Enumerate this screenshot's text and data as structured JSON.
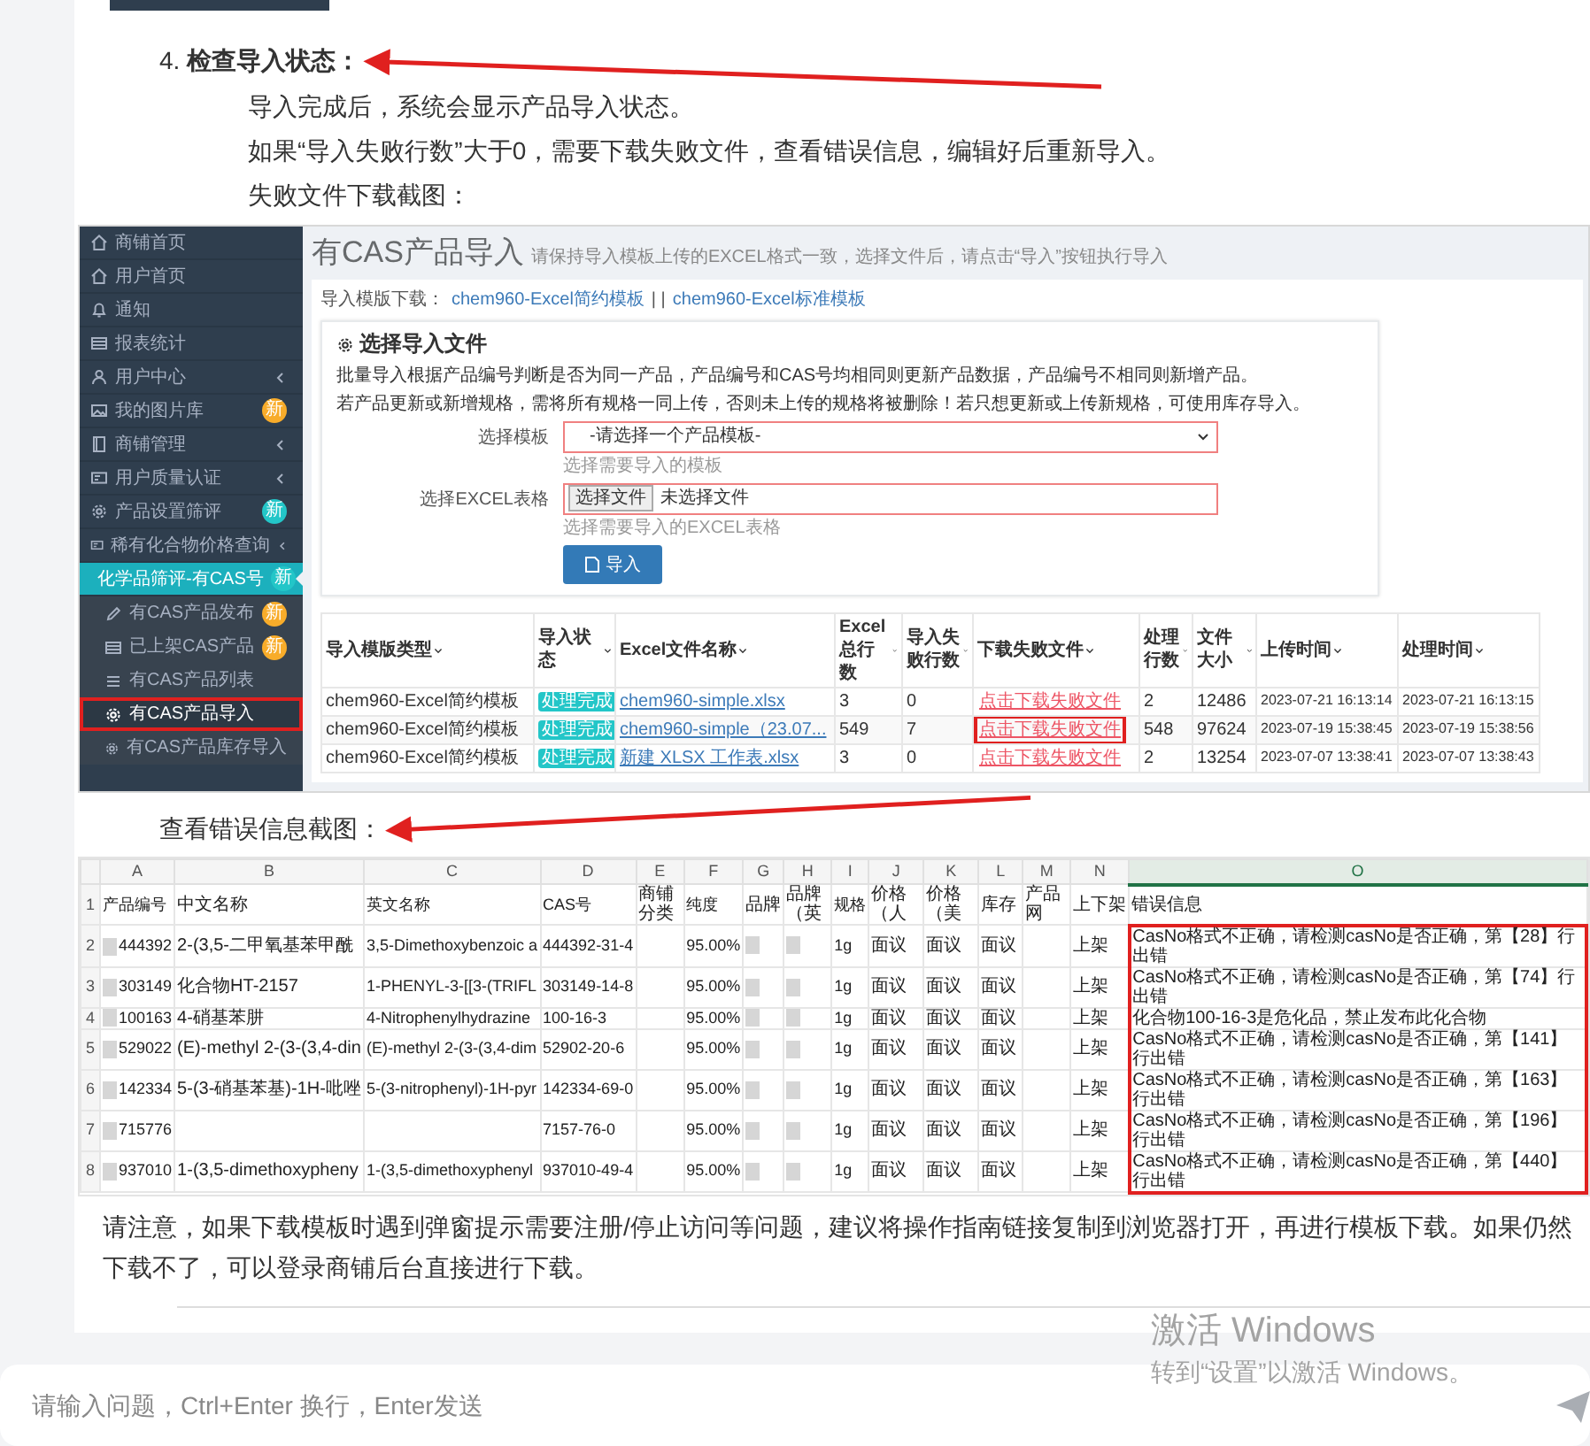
{
  "step": {
    "number": "4.",
    "title": "检查导入状态："
  },
  "paragraphs": [
    "导入完成后，系统会显示产品导入状态。",
    "如果“导入失败行数”大于0，需要下载失败文件，查看错误信息，编辑好后重新导入。",
    "失败文件下载截图："
  ],
  "screenshot": {
    "sidebar": [
      {
        "label": "商铺首页",
        "submenu": false,
        "selected": false
      },
      {
        "label": "用户首页",
        "submenu": false,
        "selected": false
      },
      {
        "label": "通知",
        "submenu": false,
        "selected": false
      },
      {
        "label": "报表统计",
        "submenu": false,
        "selected": false
      },
      {
        "label": "用户中心",
        "submenu": true,
        "selected": false
      },
      {
        "label": "我的图片库",
        "submenu": false,
        "selected": false,
        "badge": "新",
        "color": "#f8ac2a"
      },
      {
        "label": "商铺管理",
        "submenu": true,
        "selected": false
      },
      {
        "label": "用户质量认证",
        "submenu": true,
        "selected": false
      },
      {
        "label": "产品设置筛评",
        "submenu": false,
        "selected": false,
        "badge": "新",
        "color": "#23c6c8"
      },
      {
        "label": "稀有化合物价格查询",
        "submenu": true,
        "selected": false
      },
      {
        "label": "化学品筛评-有CAS号",
        "submenu": false,
        "selected": true,
        "expanded": true,
        "badge": "新",
        "color": "#23c6c8",
        "children": [
          {
            "label": "有CAS产品发布",
            "selected": false,
            "annotated": false,
            "badge": "新",
            "color": "#f8ac2a"
          },
          {
            "label": "已上架CAS产品",
            "selected": false,
            "annotated": false,
            "badge": "新",
            "color": "#f8ac2a"
          },
          {
            "label": "有CAS产品列表",
            "selected": false,
            "annotated": false
          },
          {
            "label": "有CAS产品导入",
            "selected": true,
            "annotated": true
          },
          {
            "label": "有CAS产品库存导入",
            "selected": false,
            "annotated": false
          }
        ]
      }
    ],
    "title": "有CAS产品导入",
    "subtitle": "请保持导入模板上传的EXCEL格式一致，选择文件后，请点击“导入”按钮执行导入",
    "download": {
      "label": "导入模版下载：",
      "links": [
        "chem960-Excel简约模板",
        "chem960-Excel标准模板"
      ],
      "separator": "| |"
    },
    "form": {
      "heading": "选择导入文件",
      "description": [
        "批量导入根据产品编号判断是否为同一产品，产品编号和CAS号均相同则更新产品数据，产品编号不相同则新增产品。",
        "若产品更新或新增规格，需将所有规格一同上传，否则未上传的规格将被删除！若只想更新或上传新规格，可使用库存导入。"
      ],
      "fields": [
        {
          "kind": "select",
          "label": "选择模板",
          "value": "-请选择一个产品模板-",
          "help": "选择需要导入的模板"
        },
        {
          "kind": "file",
          "label": "选择EXCEL表格",
          "button": "选择文件",
          "value": "未选择文件",
          "help": "选择需要导入的EXCEL表格"
        }
      ],
      "submit": "导入"
    },
    "table": {
      "columns": [
        "导入模版类型",
        "导入状态",
        "Excel文件名称",
        "Excel总行数",
        "导入失败行数",
        "下载失败文件",
        "处理行数",
        "文件大小",
        "上传时间",
        "处理时间"
      ],
      "rows": [
        {
          "template": "chem960-Excel简约模板",
          "status": "处理完成",
          "file": "chem960-simple.xlsx",
          "total": "3",
          "failed": "0",
          "fail_file": "点击下载失败文件",
          "annotated": false,
          "processed": "2",
          "size": "12486",
          "uploaded": "2023-07-21 16:13:14",
          "processed_at": "2023-07-21 16:13:15"
        },
        {
          "template": "chem960-Excel简约模板",
          "status": "处理完成",
          "file": "chem960-simple（23.07...",
          "total": "549",
          "failed": "7",
          "fail_file": "点击下载失败文件",
          "annotated": true,
          "processed": "548",
          "size": "97624",
          "uploaded": "2023-07-19 15:38:45",
          "processed_at": "2023-07-19 15:38:56"
        },
        {
          "template": "chem960-Excel简约模板",
          "status": "处理完成",
          "file": "新建 XLSX 工作表.xlsx",
          "total": "3",
          "failed": "0",
          "fail_file": "点击下载失败文件",
          "annotated": false,
          "processed": "2",
          "size": "13254",
          "uploaded": "2023-07-07 13:38:41",
          "processed_at": "2023-07-07 13:38:43"
        }
      ]
    }
  },
  "caption": "查看错误信息截图：",
  "spreadsheet": {
    "columns": [
      {
        "letter": "A",
        "selected": false,
        "redacted": true
      },
      {
        "letter": "B",
        "selected": false,
        "redacted": false
      },
      {
        "letter": "C",
        "selected": false,
        "redacted": false
      },
      {
        "letter": "D",
        "selected": false,
        "redacted": false
      },
      {
        "letter": "E",
        "selected": false,
        "redacted": false
      },
      {
        "letter": "F",
        "selected": false,
        "redacted": false
      },
      {
        "letter": "G",
        "selected": false,
        "redacted": true
      },
      {
        "letter": "H",
        "selected": false,
        "redacted": true
      },
      {
        "letter": "I",
        "selected": false,
        "redacted": false
      },
      {
        "letter": "J",
        "selected": false,
        "redacted": false
      },
      {
        "letter": "K",
        "selected": false,
        "redacted": false
      },
      {
        "letter": "L",
        "selected": false,
        "redacted": false
      },
      {
        "letter": "M",
        "selected": false,
        "redacted": false
      },
      {
        "letter": "N",
        "selected": false,
        "redacted": false
      },
      {
        "letter": "O",
        "selected": true,
        "redacted": false
      }
    ],
    "rows": [
      {
        "number": "1",
        "cells": {
          "A": "产品编号",
          "B": "中文名称",
          "C": "英文名称",
          "D": "CAS号",
          "E": "商铺分类",
          "F": "纯度",
          "G": "品牌",
          "H": "品牌（英",
          "I": "规格",
          "J": "价格（人",
          "K": "价格（美",
          "L": "库存",
          "M": "产品网",
          "N": "上下架",
          "O": "错误信息"
        },
        "redacted": false,
        "annotated": false
      },
      {
        "number": "2",
        "cells": {
          "A": "444392",
          "B": "2-(3,5-二甲氧基苯甲酰",
          "C": "3,5-Dimethoxybenzoic a",
          "D": "444392-31-4",
          "F": "95.00%",
          "I": "1g",
          "J": "面议",
          "K": "面议",
          "L": "面议",
          "N": "上架",
          "O": "CasNo格式不正确，请检测casNo是否正确，第【28】行出错"
        },
        "redacted": true,
        "annotated": true
      },
      {
        "number": "3",
        "cells": {
          "A": "303149",
          "B": "化合物HT-2157",
          "C": "1-PHENYL-3-[[3-(TRIFL",
          "D": "303149-14-8",
          "F": "95.00%",
          "I": "1g",
          "J": "面议",
          "K": "面议",
          "L": "面议",
          "N": "上架",
          "O": "CasNo格式不正确，请检测casNo是否正确，第【74】行出错"
        },
        "redacted": true,
        "annotated": true
      },
      {
        "number": "4",
        "cells": {
          "A": "100163",
          "B": "4-硝基苯肼",
          "C": "4-Nitrophenylhydrazine",
          "D": "100-16-3",
          "F": "95.00%",
          "I": "1g",
          "J": "面议",
          "K": "面议",
          "L": "面议",
          "N": "上架",
          "O": "化合物100-16-3是危化品，禁止发布此化合物"
        },
        "redacted": true,
        "annotated": true
      },
      {
        "number": "5",
        "cells": {
          "A": "529022",
          "B": "(E)-methyl 2-(3-(3,4-din",
          "C": "(E)-methyl 2-(3-(3,4-dim",
          "D": "52902-20-6",
          "F": "95.00%",
          "I": "1g",
          "J": "面议",
          "K": "面议",
          "L": "面议",
          "N": "上架",
          "O": "CasNo格式不正确，请检测casNo是否正确，第【141】行出错"
        },
        "redacted": true,
        "annotated": true
      },
      {
        "number": "6",
        "cells": {
          "A": "142334",
          "B": "5-(3-硝基苯基)-1H-吡唑",
          "C": "5-(3-nitrophenyl)-1H-pyr",
          "D": "142334-69-0",
          "F": "95.00%",
          "I": "1g",
          "J": "面议",
          "K": "面议",
          "L": "面议",
          "N": "上架",
          "O": "CasNo格式不正确，请检测casNo是否正确，第【163】行出错"
        },
        "redacted": true,
        "annotated": true
      },
      {
        "number": "7",
        "cells": {
          "A": "715776",
          "D": "7157-76-0",
          "F": "95.00%",
          "I": "1g",
          "J": "面议",
          "K": "面议",
          "L": "面议",
          "N": "上架",
          "O": "CasNo格式不正确，请检测casNo是否正确，第【196】行出错"
        },
        "redacted": true,
        "annotated": true
      },
      {
        "number": "8",
        "cells": {
          "A": "937010",
          "B": "1-(3,5-dimethoxypheny",
          "C": "1-(3,5-dimethoxyphenyl",
          "D": "937010-49-4",
          "F": "95.00%",
          "I": "1g",
          "J": "面议",
          "K": "面议",
          "L": "面议",
          "N": "上架",
          "O": "CasNo格式不正确，请检测casNo是否正确，第【440】行出错"
        },
        "redacted": true,
        "annotated": true
      }
    ]
  },
  "note": "请注意，如果下载模板时遇到弹窗提示需要注册/停止访问等问题，建议将操作指南链接复制到浏览器打开，再进行模板下载。如果仍然下载不了，可以登录商铺后台直接进行下载。",
  "chat_input": {
    "placeholder": "请输入问题，Ctrl+Enter 换行，Enter发送"
  },
  "windows_notice": {
    "title": "激活 Windows",
    "subtitle": "转到“设置”以激活 Windows。"
  }
}
